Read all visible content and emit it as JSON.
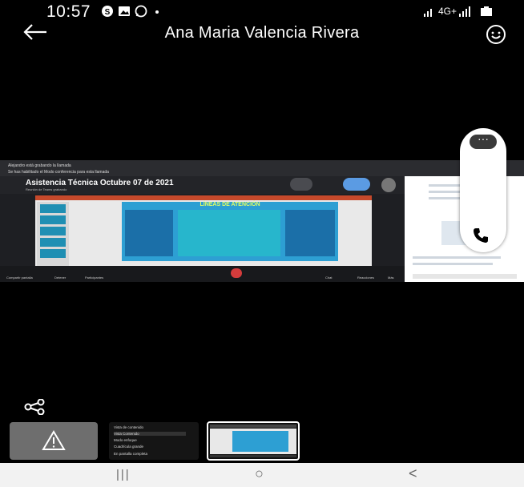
{
  "status_bar": {
    "time": "10:57",
    "network_label": "4G+",
    "icons": [
      "skype-icon",
      "gallery-icon",
      "whatsapp-icon",
      "dot-icon",
      "signal-icon",
      "battery-icon"
    ]
  },
  "header": {
    "title": "Ana Maria Valencia Rivera",
    "back_icon": "arrow-left-icon",
    "emoji_icon": "smiley-icon"
  },
  "shared_screen": {
    "notice_1": "Alejandro está grabando la llamada",
    "notice_2": "Se has habilitado el Modo conferencia para esta llamada",
    "meeting_title": "Asistencia Técnica Octubre 07 de 2021",
    "meeting_subtitle": "Reunión de Teams grabando",
    "slide_title": "LÍNEAS DE ATENCIÓN",
    "bottom_labels": [
      "Compartir pantalla",
      "Detener",
      "Participantes",
      "Chat",
      "Reacciones",
      "Más"
    ]
  },
  "call_pill": {
    "more_icon": "more-dots-icon",
    "call_icon": "phone-icon"
  },
  "share_icon": "share-icon",
  "thumbnails": {
    "warning_icon": "warning-triangle-icon",
    "menu_items": [
      "Vista de contenido",
      "Vista Contenido",
      "Modo enfoque",
      "Cuadrícula grande",
      "En pantalla completa"
    ]
  },
  "navbar": {
    "recents": "|||",
    "home": "○",
    "back": "<"
  }
}
